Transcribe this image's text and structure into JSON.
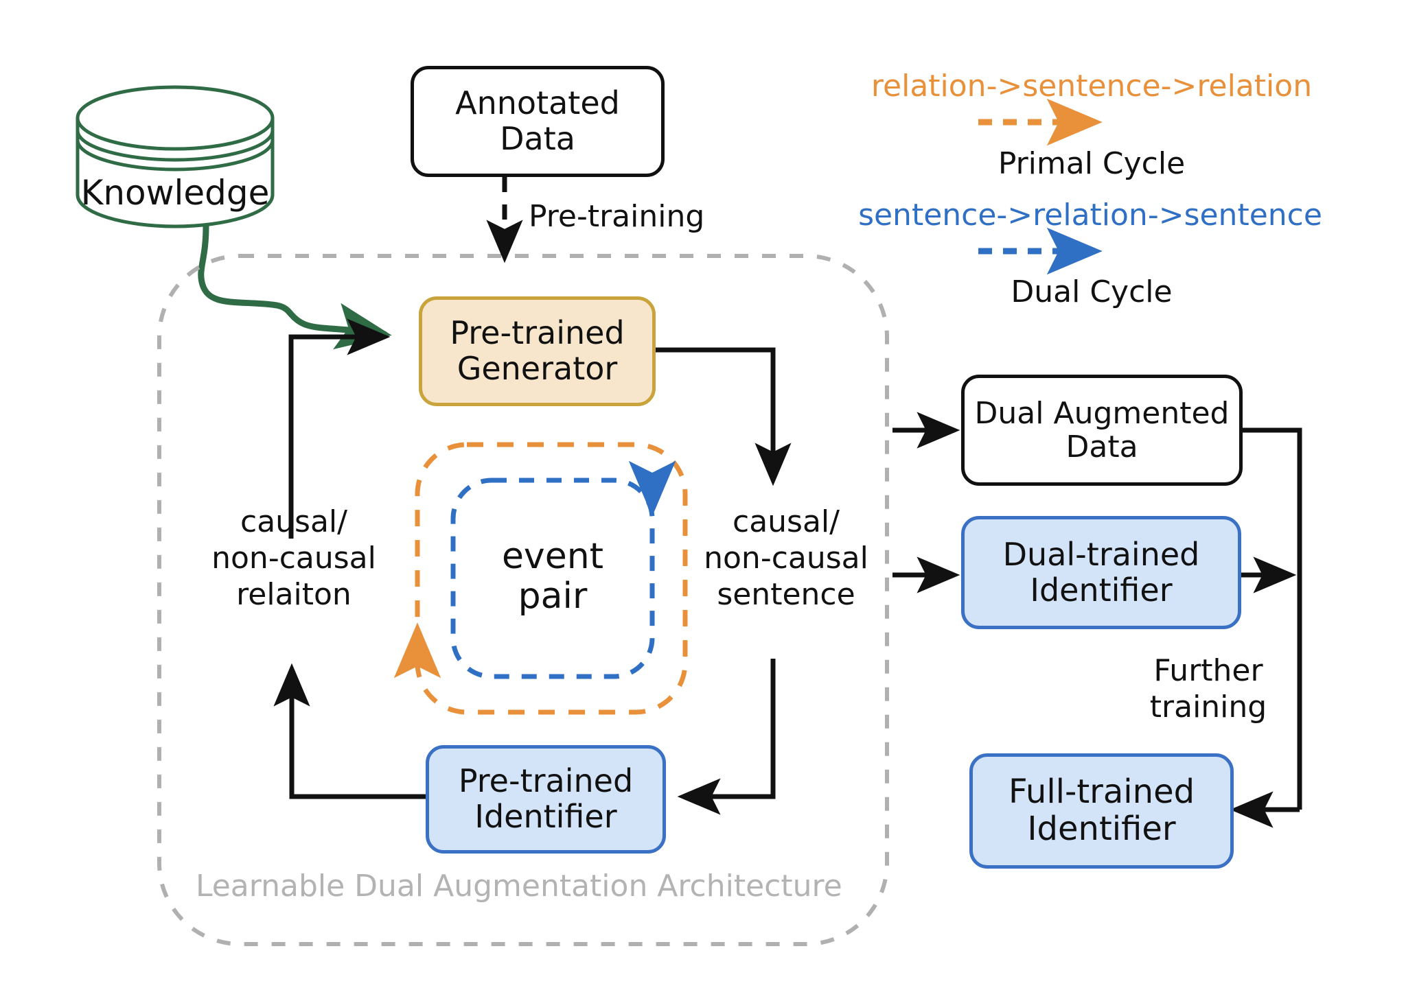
{
  "diagram": {
    "title_caption": "Learnable Dual Augmentation Architecture",
    "colors": {
      "knowledge_green": "#2f6b45",
      "generator_fill": "#f7e6cb",
      "generator_border": "#c9a33c",
      "identifier_fill": "#d3e3f8",
      "identifier_border": "#3a71c4",
      "primal_orange": "#e8903a",
      "dual_blue": "#2f6fc4",
      "container_dash": "#b0b0b0",
      "line_black": "#111111",
      "caption_gray": "#b3b3b3"
    }
  },
  "nodes": {
    "knowledge": {
      "label": "Knowledge"
    },
    "annotated_data": {
      "line1": "Annotated",
      "line2": "Data"
    },
    "pretrained_generator": {
      "line1": "Pre-trained",
      "line2": "Generator"
    },
    "pretrained_identifier": {
      "line1": "Pre-trained",
      "line2": "Identifier"
    },
    "event_pair": {
      "line1": "event",
      "line2": "pair"
    },
    "dual_augmented_data": {
      "line1": "Dual Augmented",
      "line2": "Data"
    },
    "dual_trained_identifier": {
      "line1": "Dual-trained",
      "line2": "Identifier"
    },
    "full_trained_identifier": {
      "line1": "Full-trained",
      "line2": "Identifier"
    }
  },
  "edge_labels": {
    "pre_training": "Pre-training",
    "left_relation": {
      "line1": "causal/",
      "line2": "non-causal",
      "line3": "relaiton"
    },
    "right_sentence": {
      "line1": "causal/",
      "line2": "non-causal",
      "line3": "sentence"
    },
    "further_training": {
      "line1": "Further",
      "line2": "training"
    }
  },
  "legend": {
    "primal": {
      "formula": "relation->sentence->relation",
      "name": "Primal Cycle",
      "color": "#e8903a"
    },
    "dual": {
      "formula": "sentence->relation->sentence",
      "name": "Dual Cycle",
      "color": "#2f6fc4"
    }
  }
}
